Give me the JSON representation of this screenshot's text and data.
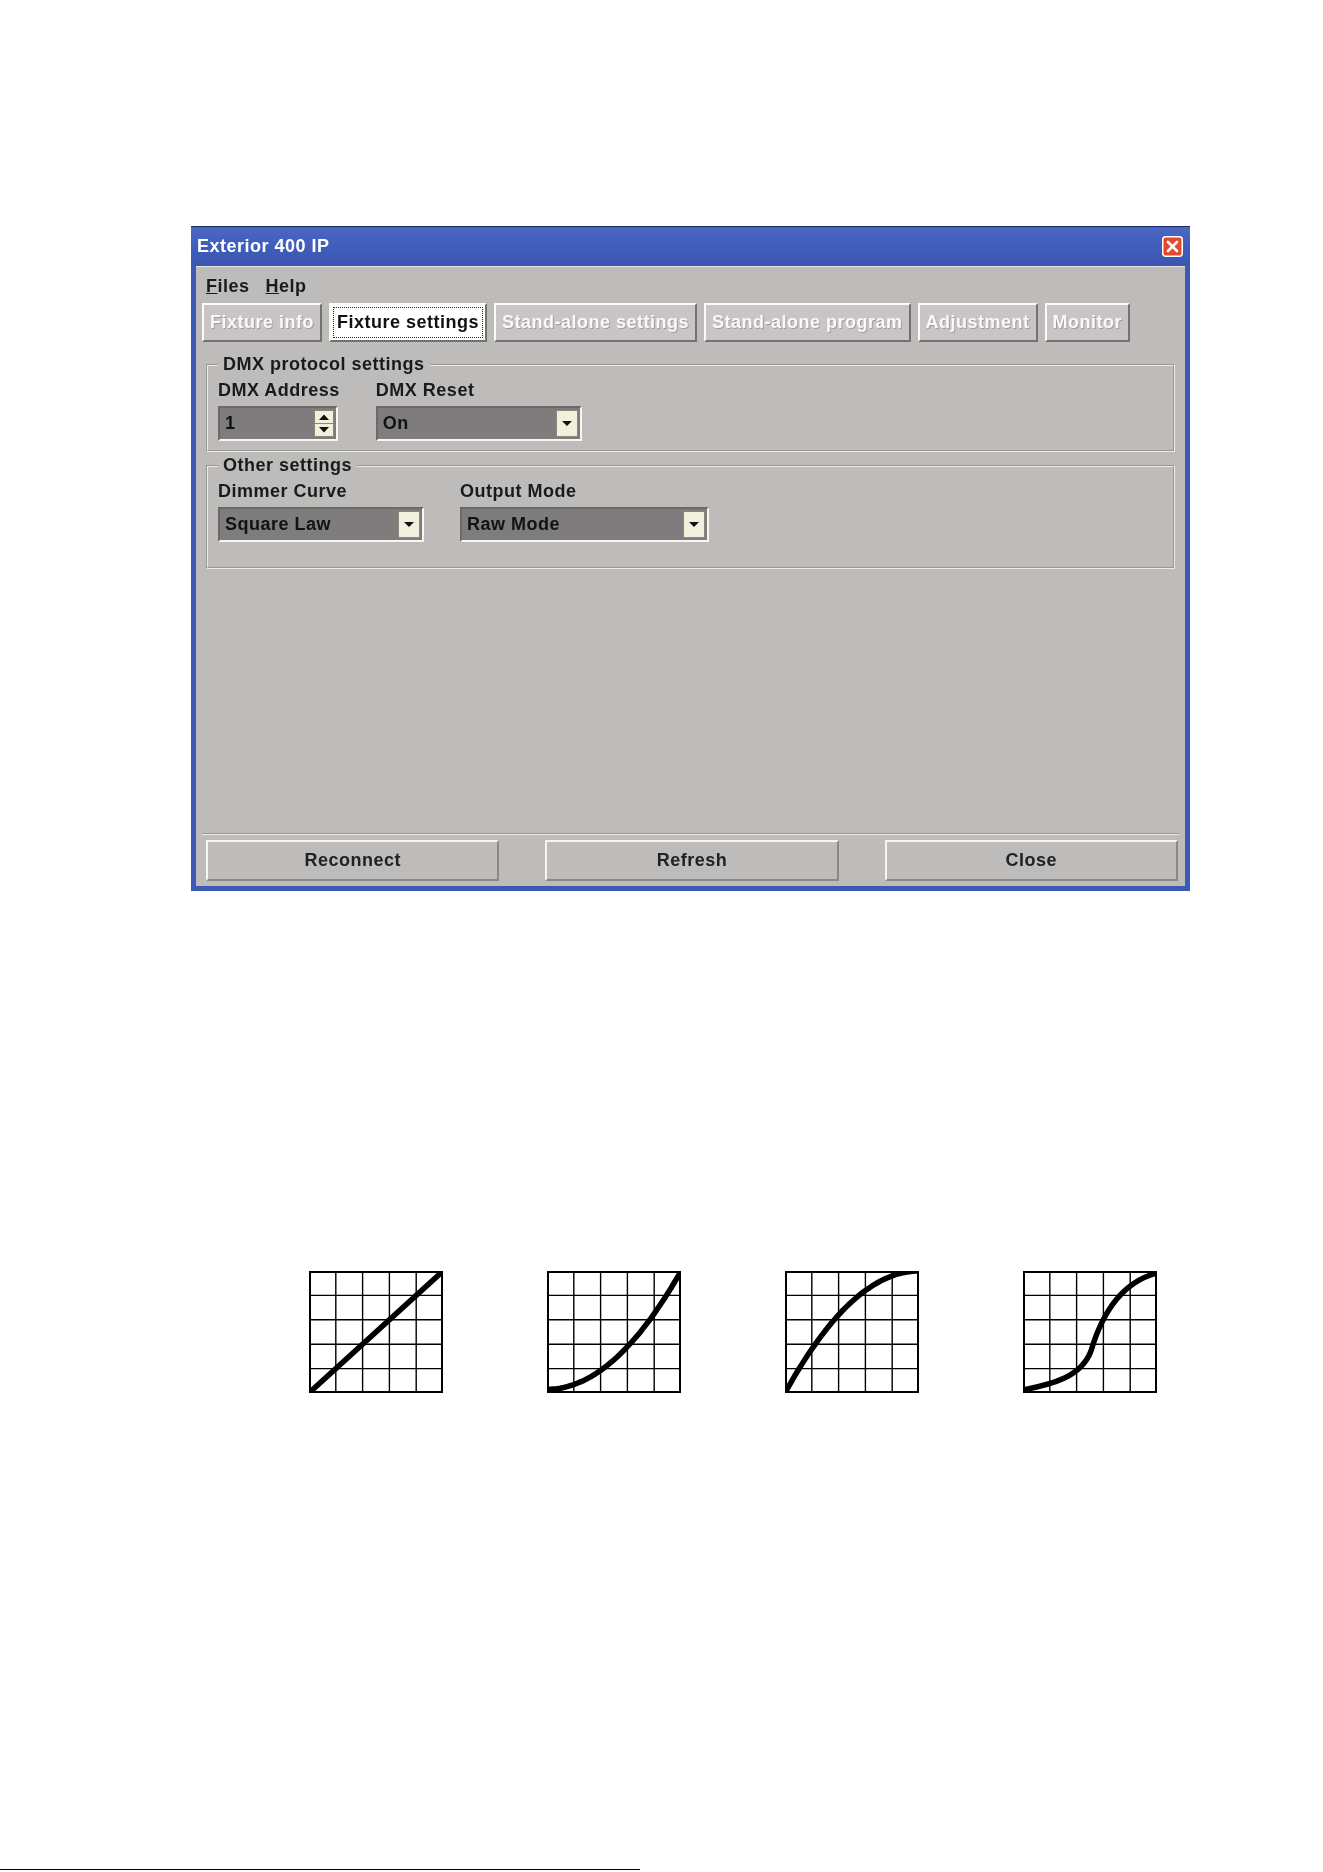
{
  "window": {
    "title": "Exterior 400 IP"
  },
  "menu": [
    "Files",
    "Help"
  ],
  "tabs": [
    {
      "label": "Fixture info",
      "selected": false
    },
    {
      "label": "Fixture settings",
      "selected": true
    },
    {
      "label": "Stand-alone settings",
      "selected": false
    },
    {
      "label": "Stand-alone program",
      "selected": false
    },
    {
      "label": "Adjustment",
      "selected": false
    },
    {
      "label": "Monitor",
      "selected": false
    }
  ],
  "groups": [
    {
      "title": "DMX protocol settings",
      "fields": [
        {
          "kind": "spinner",
          "label": "DMX Address",
          "value": "1"
        },
        {
          "kind": "dropdown",
          "label": "DMX Reset",
          "value": "On"
        }
      ]
    },
    {
      "title": "Other settings",
      "fields": [
        {
          "kind": "dropdown",
          "label": "Dimmer Curve",
          "value": "Square Law"
        },
        {
          "kind": "dropdown",
          "label": "Output Mode",
          "value": "Raw Mode"
        }
      ]
    }
  ],
  "buttons": [
    "Reconnect",
    "Refresh",
    "Close"
  ],
  "curve_graphs": [
    {
      "kind": "linear"
    },
    {
      "kind": "square"
    },
    {
      "kind": "root"
    },
    {
      "kind": "scurve"
    }
  ]
}
